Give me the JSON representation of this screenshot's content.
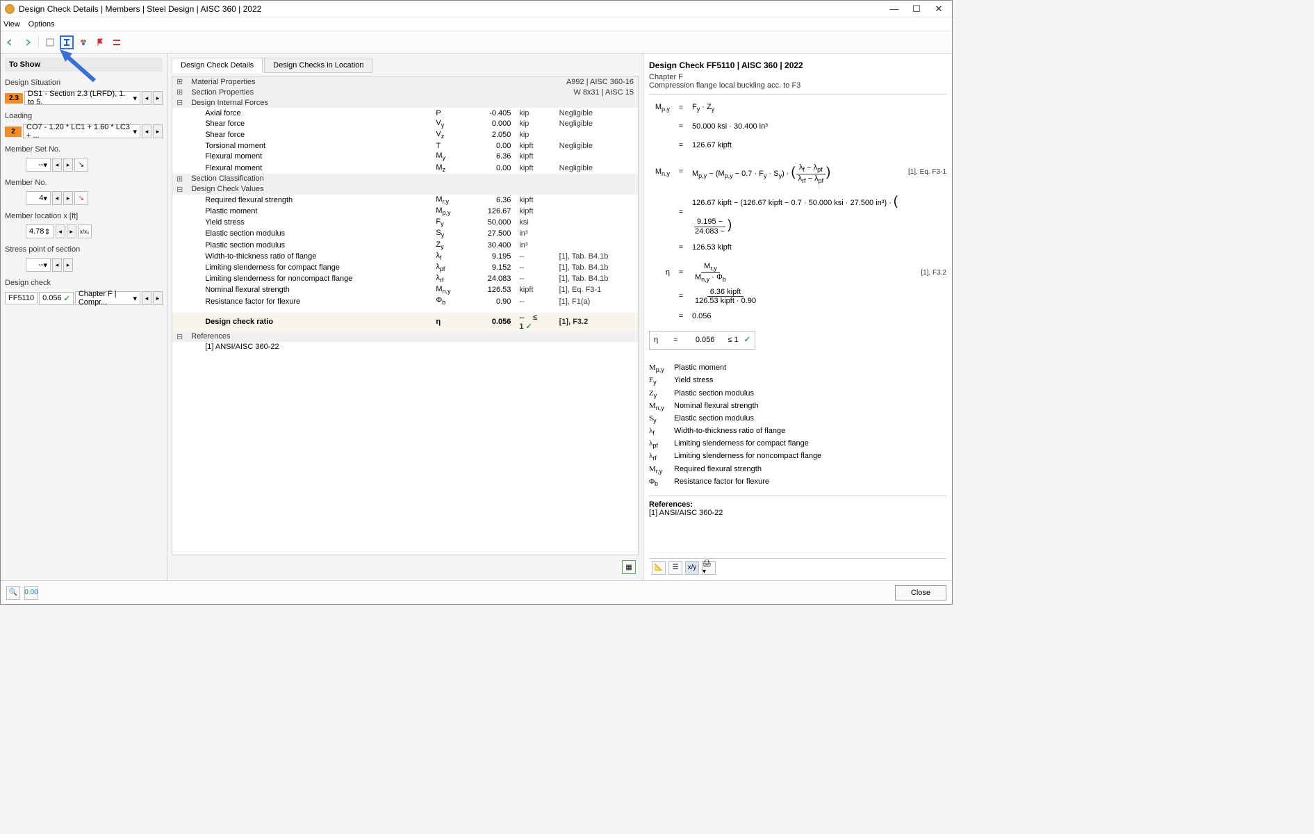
{
  "title": "Design Check Details | Members | Steel Design | AISC 360 | 2022",
  "menu": {
    "view": "View",
    "options": "Options"
  },
  "sidebar": {
    "toshow": "To Show",
    "design_situation": "Design Situation",
    "ds_badge": "2.3",
    "ds_combo": "DS1 - Section 2.3 (LRFD), 1. to 5.",
    "loading": "Loading",
    "loading_badge": "2",
    "loading_combo": "CO7 - 1.20 * LC1 + 1.60 * LC3 + ...",
    "member_set_no": "Member Set No.",
    "member_set_val": "--",
    "member_no": "Member No.",
    "member_no_val": "4",
    "member_loc": "Member location x [ft]",
    "member_loc_val": "4.78",
    "stress_point": "Stress point of section",
    "stress_val": "--",
    "design_check": "Design check",
    "dc_id": "FF5110",
    "dc_ratio": "0.056",
    "dc_text": "Chapter F | Compr..."
  },
  "tabs": {
    "details": "Design Check Details",
    "location": "Design Checks in Location"
  },
  "grid": {
    "material_props": "Material Properties",
    "material_meta": "A992 | AISC 360-16",
    "section_props": "Section Properties",
    "section_meta": "W 8x31 | AISC 15",
    "internal_forces": "Design Internal Forces",
    "forces": [
      {
        "name": "Axial force",
        "sym": "P",
        "val": "-0.405",
        "unit": "kip",
        "note": "Negligible"
      },
      {
        "name": "Shear force",
        "sym": "V",
        "sub": "y",
        "val": "0.000",
        "unit": "kip",
        "note": "Negligible"
      },
      {
        "name": "Shear force",
        "sym": "V",
        "sub": "z",
        "val": "2.050",
        "unit": "kip",
        "note": ""
      },
      {
        "name": "Torsional moment",
        "sym": "T",
        "val": "0.00",
        "unit": "kipft",
        "note": "Negligible"
      },
      {
        "name": "Flexural moment",
        "sym": "M",
        "sub": "y",
        "val": "6.36",
        "unit": "kipft",
        "note": ""
      },
      {
        "name": "Flexural moment",
        "sym": "M",
        "sub": "z",
        "val": "0.00",
        "unit": "kipft",
        "note": "Negligible"
      }
    ],
    "section_class": "Section Classification",
    "check_values": "Design Check Values",
    "values": [
      {
        "name": "Required flexural strength",
        "sym": "M",
        "sub": "r,y",
        "val": "6.36",
        "unit": "kipft",
        "note": ""
      },
      {
        "name": "Plastic moment",
        "sym": "M",
        "sub": "p,y",
        "val": "126.67",
        "unit": "kipft",
        "note": ""
      },
      {
        "name": "Yield stress",
        "sym": "F",
        "sub": "y",
        "val": "50.000",
        "unit": "ksi",
        "note": ""
      },
      {
        "name": "Elastic section modulus",
        "sym": "S",
        "sub": "y",
        "val": "27.500",
        "unit": "in³",
        "note": ""
      },
      {
        "name": "Plastic section modulus",
        "sym": "Z",
        "sub": "y",
        "val": "30.400",
        "unit": "in³",
        "note": ""
      },
      {
        "name": "Width-to-thickness ratio of flange",
        "sym": "λ",
        "sub": "f",
        "val": "9.195",
        "unit": "--",
        "note": "[1], Tab. B4.1b"
      },
      {
        "name": "Limiting slenderness for compact flange",
        "sym": "λ",
        "sub": "pf",
        "val": "9.152",
        "unit": "--",
        "note": "[1], Tab. B4.1b"
      },
      {
        "name": "Limiting slenderness for noncompact flange",
        "sym": "λ",
        "sub": "rf",
        "val": "24.083",
        "unit": "--",
        "note": "[1], Tab. B4.1b"
      },
      {
        "name": "Nominal flexural strength",
        "sym": "M",
        "sub": "n,y",
        "val": "126.53",
        "unit": "kipft",
        "note": "[1], Eq. F3-1"
      },
      {
        "name": "Resistance factor for flexure",
        "sym": "Φ",
        "sub": "b",
        "val": "0.90",
        "unit": "--",
        "note": "[1], F1(a)"
      }
    ],
    "ratio_label": "Design check ratio",
    "ratio_sym": "η",
    "ratio_val": "0.056",
    "ratio_unit": "--",
    "ratio_limit": "≤ 1",
    "ratio_note": "[1], F3.2",
    "references": "References",
    "ref1": "[1]  ANSI/AISC 360-22"
  },
  "right": {
    "header": "Design Check FF5110 | AISC 360 | 2022",
    "chapter": "Chapter F",
    "desc": "Compression flange local buckling acc. to F3",
    "f1_lhs": "M",
    "f1_sub": "p,y",
    "f1_rhs": "F",
    "f1_rhs_sub": "y",
    "f1_dot": "·",
    "f1_z": "Z",
    "f1_zsub": "y",
    "f1_v1": "50.000 ksi",
    "f1_v2": "30.400 in³",
    "f1_res": "126.67 kipft",
    "f2_lhs": "M",
    "f2_sub": "n,y",
    "f2_ref": "[1], Eq. F3-1",
    "f2_expr_a": "M",
    "f2_expr_asub": "p,y",
    "f2_07": "0.7",
    "f2_fy": "F",
    "f2_fysub": "y",
    "f2_sy": "S",
    "f2_sysub": "y",
    "f2_lf": "λ",
    "f2_lfsub": "f",
    "f2_lpf": "λ",
    "f2_lpfsub": "pf",
    "f2_lrf": "λ",
    "f2_lrfsub": "rf",
    "f2_num1": "126.67 kipft",
    "f2_num2": "126.67 kipft",
    "f2_num3": "0.7",
    "f2_num4": "50.000 ksi",
    "f2_num5": "27.500 in³",
    "f2_frac_n": "9.195  −",
    "f2_frac_d": "24.083  −",
    "f2_res": "126.53 kipft",
    "f3_lhs": "η",
    "f3_ref": "[1], F3.2",
    "f3_mr": "M",
    "f3_mrsub": "r,y",
    "f3_mn": "M",
    "f3_mnsub": "n,y",
    "f3_phi": "Φ",
    "f3_phisub": "b",
    "f3_num": "6.36 kipft",
    "f3_den1": "126.53 kipft",
    "f3_den2": "0.90",
    "f3_res": "0.056",
    "eta_sym": "η",
    "eta_eq": "=",
    "eta_val": "0.056",
    "eta_lim": "≤ 1",
    "legend": [
      {
        "s": "M",
        "sub": "p,y",
        "d": "Plastic moment"
      },
      {
        "s": "F",
        "sub": "y",
        "d": "Yield stress"
      },
      {
        "s": "Z",
        "sub": "y",
        "d": "Plastic section modulus"
      },
      {
        "s": "M",
        "sub": "n,y",
        "d": "Nominal flexural strength"
      },
      {
        "s": "S",
        "sub": "y",
        "d": "Elastic section modulus"
      },
      {
        "s": "λ",
        "sub": "f",
        "d": "Width-to-thickness ratio of flange"
      },
      {
        "s": "λ",
        "sub": "pf",
        "d": "Limiting slenderness for compact flange"
      },
      {
        "s": "λ",
        "sub": "rf",
        "d": "Limiting slenderness for noncompact flange"
      },
      {
        "s": "M",
        "sub": "r,y",
        "d": "Required flexural strength"
      },
      {
        "s": "Φ",
        "sub": "b",
        "d": "Resistance factor for flexure"
      }
    ],
    "refs_label": "References:",
    "refs_item": "[1]  ANSI/AISC 360-22"
  },
  "footer": {
    "close": "Close"
  }
}
